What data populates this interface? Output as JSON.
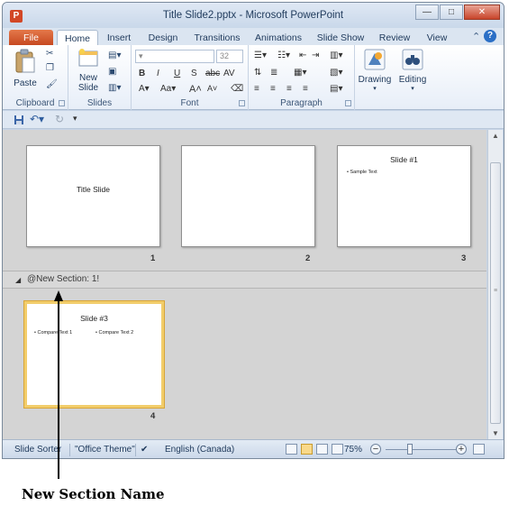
{
  "window": {
    "title": "Title Slide2.pptx - Microsoft PowerPoint",
    "app_icon_letter": "P",
    "minimize": "—",
    "maximize": "□",
    "close": "✕"
  },
  "tabs": {
    "file": "File",
    "home": "Home",
    "insert": "Insert",
    "design": "Design",
    "transitions": "Transitions",
    "animations": "Animations",
    "slide_show": "Slide Show",
    "review": "Review",
    "view": "View",
    "help": "?"
  },
  "ribbon": {
    "clipboard": {
      "label": "Clipboard",
      "paste": "Paste"
    },
    "slides": {
      "label": "Slides",
      "new_slide_line1": "New",
      "new_slide_line2": "Slide"
    },
    "font": {
      "label": "Font",
      "size": "32"
    },
    "paragraph": {
      "label": "Paragraph"
    },
    "drawing": {
      "label": "Drawing"
    },
    "editing": {
      "label": "Editing"
    }
  },
  "sorter": {
    "slides": [
      {
        "number": "1",
        "title": "Title Slide",
        "bullets": []
      },
      {
        "number": "2",
        "title": "",
        "bullets": []
      },
      {
        "number": "3",
        "title": "Slide #1",
        "bullets": [
          "Sample Text"
        ]
      },
      {
        "number": "4",
        "title": "Slide #3",
        "bullets": [
          "Compare Text 1",
          "Compare Text 2"
        ]
      }
    ],
    "section_name": "@New Section: 1!"
  },
  "status": {
    "view_name": "Slide Sorter",
    "theme": "\"Office Theme\"",
    "language": "English (Canada)",
    "zoom": "75%",
    "zoom_out": "−",
    "zoom_in": "+"
  },
  "annotation": {
    "label": "New Section Name"
  },
  "colors": {
    "file_tab": "#d24726",
    "selected_slide_border": "#f2cd6b",
    "help_icon": "#2b6fc6"
  }
}
